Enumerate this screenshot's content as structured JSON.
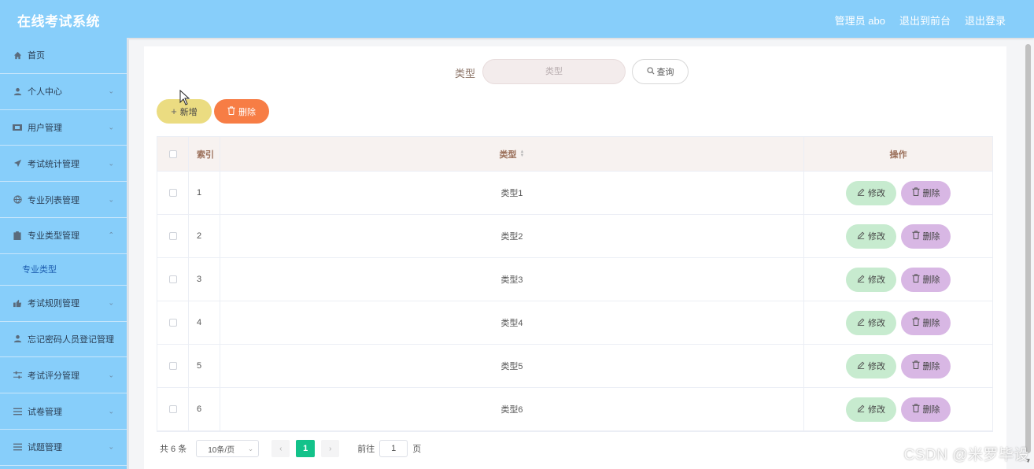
{
  "header": {
    "title": "在线考试系统",
    "user": "管理员 abo",
    "front_link": "退出到前台",
    "logout_link": "退出登录"
  },
  "sidebar": {
    "items": [
      {
        "label": "首页",
        "icon": "home-icon"
      },
      {
        "label": "个人中心",
        "icon": "user-icon"
      },
      {
        "label": "用户管理",
        "icon": "ticket-icon"
      },
      {
        "label": "考试统计管理",
        "icon": "send-icon"
      },
      {
        "label": "专业列表管理",
        "icon": "globe-icon"
      },
      {
        "label": "专业类型管理",
        "icon": "clipboard-icon"
      },
      {
        "label": "考试规则管理",
        "icon": "thumb-icon"
      },
      {
        "label": "忘记密码人员登记管理",
        "icon": "user-icon"
      },
      {
        "label": "考试评分管理",
        "icon": "sliders-icon"
      },
      {
        "label": "试卷管理",
        "icon": "list-icon"
      },
      {
        "label": "试题管理",
        "icon": "list-icon"
      }
    ],
    "sub_item": "专业类型"
  },
  "search": {
    "label": "类型",
    "placeholder": "类型",
    "button": "查询"
  },
  "toolbar": {
    "add_label": "新增",
    "delete_label": "删除"
  },
  "table": {
    "columns": [
      "索引",
      "类型",
      "操作"
    ],
    "rows": [
      {
        "index": "1",
        "type": "类型1"
      },
      {
        "index": "2",
        "type": "类型2"
      },
      {
        "index": "3",
        "type": "类型3"
      },
      {
        "index": "4",
        "type": "类型4"
      },
      {
        "index": "5",
        "type": "类型5"
      },
      {
        "index": "6",
        "type": "类型6"
      }
    ],
    "edit_label": "修改",
    "delete_label": "删除"
  },
  "pagination": {
    "total": "共 6 条",
    "page_size": "10条/页",
    "current_page": "1",
    "goto_label": "前往",
    "goto_value": "1",
    "page_suffix": "页"
  },
  "watermark": "CSDN @米罗毕设",
  "colors": {
    "header_bg": "#87cefa",
    "add_button": "#ebdc81",
    "delete_button": "#f77d45",
    "edit_row_button": "#c7ebcf",
    "delete_row_button": "#d8b7e4",
    "active_page": "#13c28a"
  }
}
